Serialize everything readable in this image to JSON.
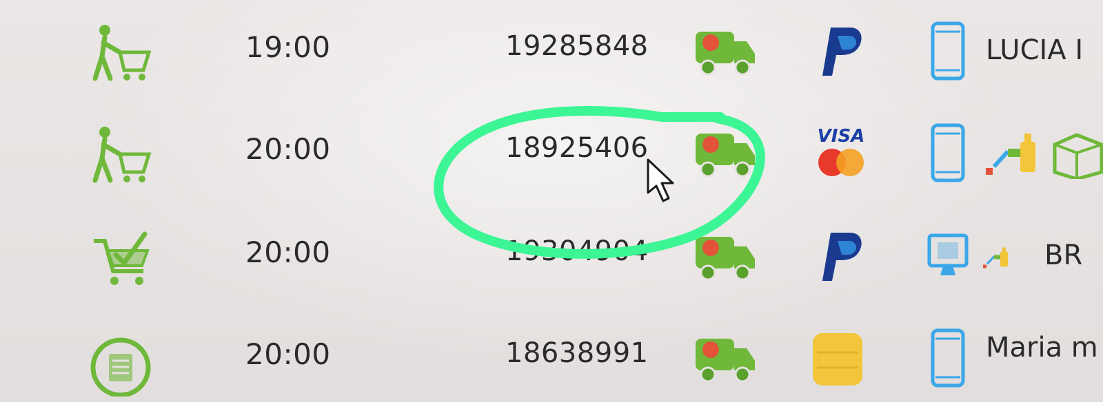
{
  "rows": [
    {
      "type_icon": "person-with-cart-icon",
      "time": "19:00",
      "order_number": "19285848",
      "delivery_icon": "delivery-truck-icon",
      "payment_icon": "paypal-icon",
      "device_icon": "smartphone-icon",
      "customer": "LUCIA I"
    },
    {
      "type_icon": "person-with-cart-icon",
      "time": "20:00",
      "order_number": "18925406",
      "delivery_icon": "delivery-truck-icon",
      "payment_icon": "visa-mastercard-icon",
      "device_icon": "smartphone-icon",
      "extra_icons": [
        "products-icon",
        "box-icon"
      ],
      "customer": ""
    },
    {
      "type_icon": "shopping-cart-check-icon",
      "time": "20:00",
      "order_number": "19304904",
      "delivery_icon": "delivery-truck-icon",
      "payment_icon": "paypal-icon",
      "device_icon": "desktop-monitor-icon",
      "extra_icons": [
        "products-icon"
      ],
      "customer": "BR"
    },
    {
      "type_icon": "list-document-icon",
      "time": "20:00",
      "order_number": "18638991",
      "delivery_icon": "delivery-truck-icon",
      "payment_icon": "cash-icon",
      "device_icon": "smartphone-icon",
      "customer": "Maria m"
    }
  ],
  "annotation": {
    "shape": "hand-drawn-ellipse",
    "color": "#3cf595",
    "target": "order_number row 2"
  },
  "colors": {
    "green_icon": "#6fb83a",
    "truck_red": "#e2533a",
    "paypal_dark": "#1a3a8f",
    "paypal_light": "#2d83d4",
    "visa_blue": "#1c3fa6",
    "mastercard_red": "#e73a2a",
    "mastercard_orange": "#f5a123",
    "device_blue": "#3aa7e8",
    "cash_yellow": "#f2c53a"
  }
}
